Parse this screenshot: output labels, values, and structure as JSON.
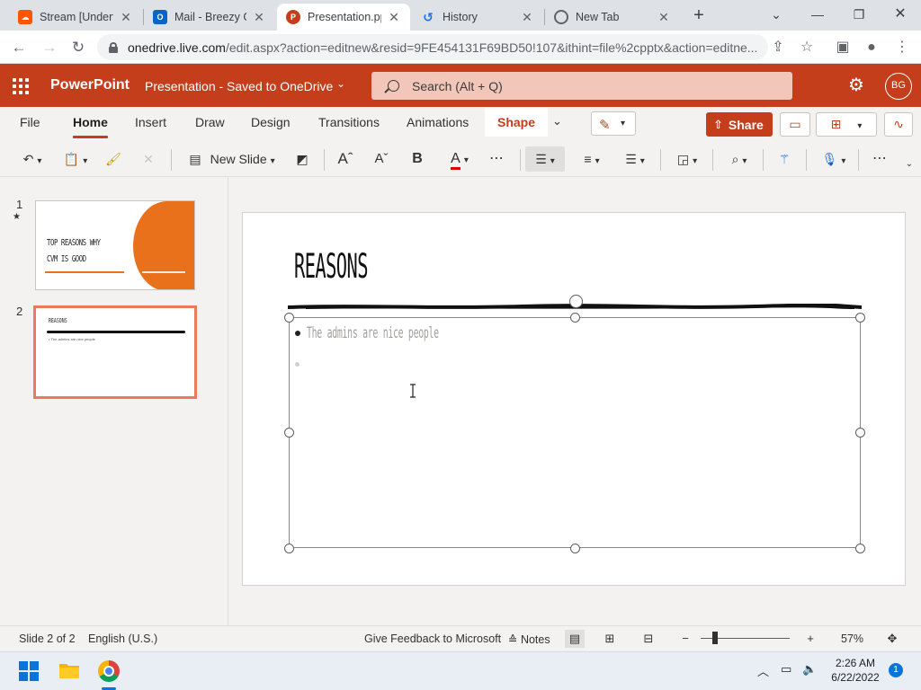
{
  "browser": {
    "tabs": [
      {
        "label": "Stream [Underta",
        "icon": "soundcloud-icon",
        "color": "#ff5500"
      },
      {
        "label": "Mail - Breezy Ge",
        "icon": "outlook-icon",
        "color": "#0a64c8"
      },
      {
        "label": "Presentation.pp",
        "icon": "powerpoint-icon",
        "color": "#c43e1c"
      },
      {
        "label": "History",
        "icon": "history-icon",
        "color": "#1a73e8"
      },
      {
        "label": "New Tab",
        "icon": "chrome-icon",
        "color": "#5f6368"
      }
    ],
    "active_tab": 2,
    "url_host": "onedrive.live.com",
    "url_rest": "/edit.aspx?action=editnew&resid=9FE454131F69BD50!107&ithint=file%2cpptx&action=editne..."
  },
  "app": {
    "name": "PowerPoint",
    "doc_title": "Presentation  -  Saved to OneDrive",
    "search_placeholder": "Search (Alt + Q)",
    "user_initials": "BG",
    "accent": "#c43e1c"
  },
  "ribbon": {
    "tabs": [
      "File",
      "Home",
      "Insert",
      "Draw",
      "Design",
      "Transitions",
      "Animations",
      "Shape"
    ],
    "active_tab": "Home",
    "share_label": "Share",
    "new_slide_label": "New Slide"
  },
  "thumbnails": [
    {
      "number": "1",
      "title_line1": "TOP REASONS WHY",
      "title_line2": "CVM IS GOOD"
    },
    {
      "number": "2",
      "title": "REASONS",
      "bullet": "The admins are nice people"
    }
  ],
  "slide": {
    "title": "REASONS",
    "bullet": "The admins are nice people"
  },
  "status": {
    "slide_count": "Slide 2 of 2",
    "language": "English (U.S.)",
    "feedback": "Give Feedback to Microsoft",
    "notes": "Notes",
    "zoom": "57%"
  },
  "taskbar": {
    "time": "2:26 AM",
    "date": "6/22/2022",
    "notifications": "1"
  }
}
